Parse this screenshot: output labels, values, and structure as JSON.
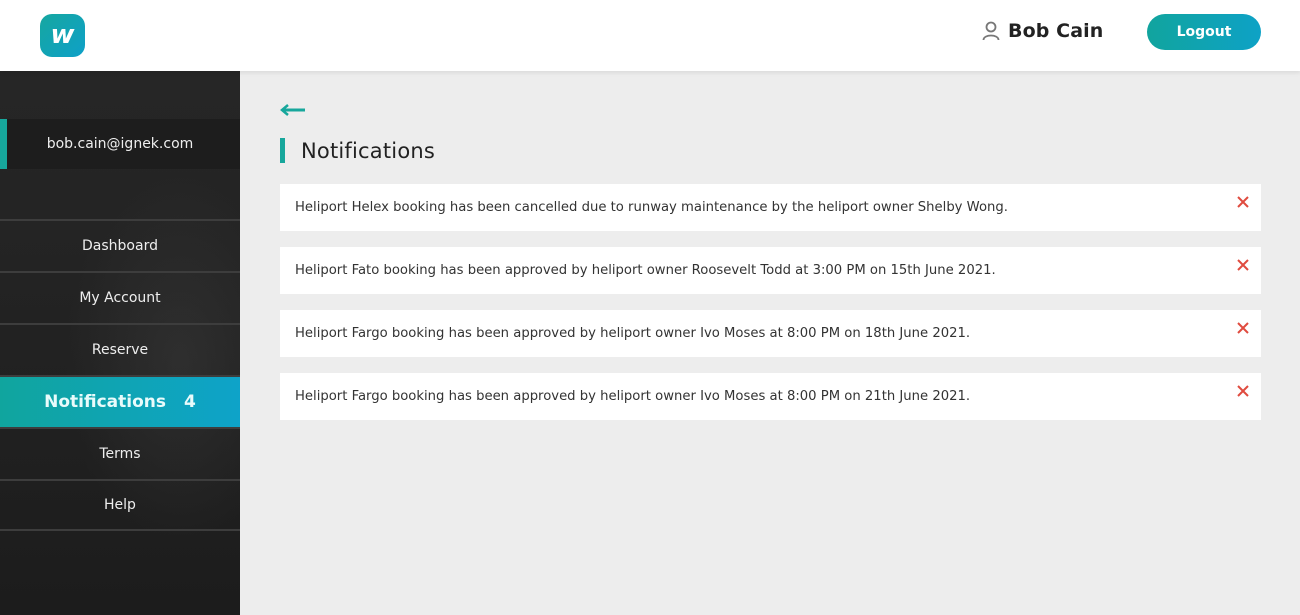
{
  "header": {
    "logo_glyph": "w",
    "user_name": "Bob Cain",
    "logout_label": "Logout"
  },
  "sidebar": {
    "email": "bob.cain@ignek.com",
    "items": [
      {
        "label": "Dashboard"
      },
      {
        "label": "My Account"
      },
      {
        "label": "Reserve"
      },
      {
        "label": "Notifications",
        "badge": "4",
        "active": true
      },
      {
        "label": "Terms"
      },
      {
        "label": "Help"
      }
    ]
  },
  "main": {
    "title": "Notifications",
    "notifications": [
      {
        "text": "Heliport Helex booking has been cancelled due to runway maintenance by the heliport owner Shelby Wong."
      },
      {
        "text": "Heliport Fato booking has been approved by heliport owner Roosevelt Todd at 3:00 PM on 15th June 2021."
      },
      {
        "text": "Heliport Fargo booking has been approved by heliport owner Ivo Moses at 8:00 PM on 18th June 2021."
      },
      {
        "text": "Heliport Fargo booking has been approved by heliport owner Ivo Moses at 8:00 PM on 21th June 2021."
      }
    ]
  },
  "colors": {
    "accent": "#17a79c",
    "gradient_end": "#0ea2c6",
    "close": "#e04b3f",
    "sidebar_bg": "#222222",
    "main_bg": "#ededed"
  }
}
